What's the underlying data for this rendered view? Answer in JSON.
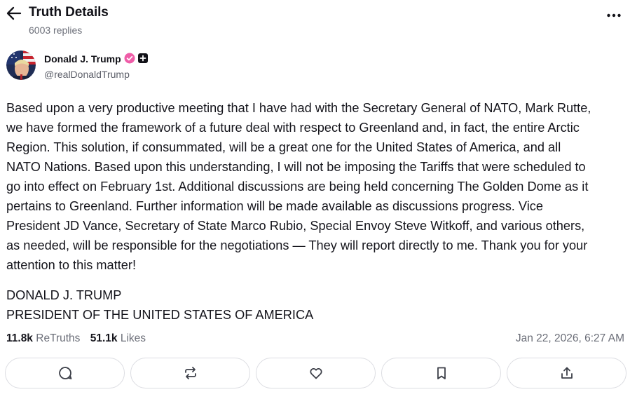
{
  "header": {
    "title": "Truth Details",
    "replies": "6003 replies",
    "back_icon": "arrow-left-icon",
    "more_icon": "dots-horizontal-icon"
  },
  "author": {
    "name": "Donald J. Trump",
    "handle": "@realDonaldTrump",
    "verified_color": "#ef5da8"
  },
  "post": {
    "body": "Based upon a very productive meeting that I have had with the Secretary General of NATO, Mark Rutte,\nwe have formed the framework of a future deal with respect to Greenland and, in fact, the entire Arctic\nRegion. This solution, if consummated, will be a great one for the United States of America, and all\nNATO Nations. Based upon this understanding, I will not be imposing the Tariffs that were scheduled to\ngo into effect on February 1st. Additional discussions are being held concerning The Golden Dome as it\npertains to Greenland. Further information will be made available as discussions progress. Vice\nPresident JD Vance, Secretary of State Marco Rubio, Special Envoy Steve Witkoff, and various others,\nas needed, will be responsible for the negotiations — They will report directly to me. Thank you for your\nattention to this matter!",
    "signature_line1": "DONALD J. TRUMP",
    "signature_line2": "PRESIDENT OF THE UNITED STATES OF AMERICA"
  },
  "stats": {
    "retruths_count": "11.8k",
    "retruths_label": "ReTruths",
    "likes_count": "51.1k",
    "likes_label": "Likes",
    "timestamp": "Jan 22, 2026, 6:27 AM"
  },
  "actions": [
    {
      "icon": "comment-icon"
    },
    {
      "icon": "retruth-icon"
    },
    {
      "icon": "heart-icon"
    },
    {
      "icon": "bookmark-icon"
    },
    {
      "icon": "share-icon"
    }
  ]
}
